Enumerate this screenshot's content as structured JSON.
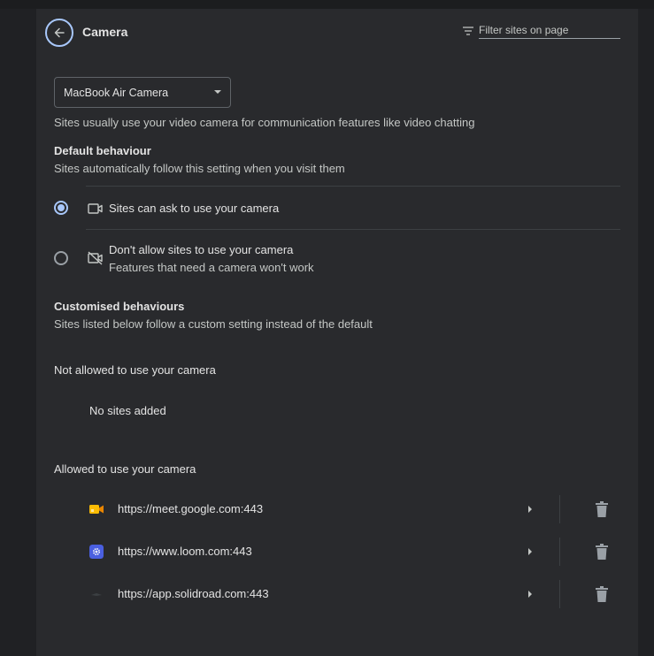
{
  "header": {
    "title": "Camera",
    "filter_placeholder": "Filter sites on page"
  },
  "camera_select": {
    "value": "MacBook Air Camera"
  },
  "description": "Sites usually use your video camera for communication features like video chatting",
  "default_behaviour": {
    "heading": "Default behaviour",
    "subtitle": "Sites automatically follow this setting when you visit them",
    "options": [
      {
        "label": "Sites can ask to use your camera",
        "selected": true,
        "icon": "camera-icon"
      },
      {
        "label": "Don't allow sites to use your camera",
        "sublabel": "Features that need a camera won't work",
        "selected": false,
        "icon": "camera-off-icon"
      }
    ]
  },
  "customised_behaviours": {
    "heading": "Customised behaviours",
    "subtitle": "Sites listed below follow a custom setting instead of the default"
  },
  "not_allowed": {
    "heading": "Not allowed to use your camera",
    "empty_text": "No sites added"
  },
  "allowed": {
    "heading": "Allowed to use your camera",
    "sites": [
      {
        "url": "https://meet.google.com:443",
        "favicon": "google-meet-icon"
      },
      {
        "url": "https://www.loom.com:443",
        "favicon": "loom-icon"
      },
      {
        "url": "https://app.solidroad.com:443",
        "favicon": "solidroad-icon"
      }
    ]
  },
  "colors": {
    "accent": "#a8c7fa",
    "background": "#202124",
    "card": "#292a2d"
  }
}
